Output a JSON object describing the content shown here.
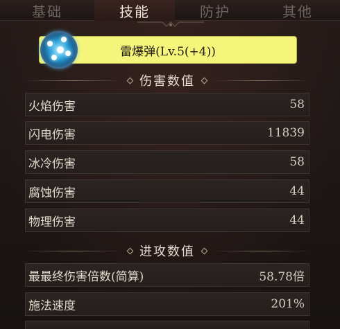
{
  "tabs": [
    {
      "label": "基础"
    },
    {
      "label": "技能"
    },
    {
      "label": "防护"
    },
    {
      "label": "其他"
    }
  ],
  "skill": {
    "name": "雷爆弹(Lv.5(+4))",
    "icon": "lightning-orb-icon"
  },
  "sections": [
    {
      "title": "伤害数值",
      "rows": [
        {
          "label": "火焰伤害",
          "value": "58"
        },
        {
          "label": "闪电伤害",
          "value": "11839"
        },
        {
          "label": "冰冷伤害",
          "value": "58"
        },
        {
          "label": "腐蚀伤害",
          "value": "44"
        },
        {
          "label": "物理伤害",
          "value": "44"
        }
      ]
    },
    {
      "title": "进攻数值",
      "rows": [
        {
          "label": "最最终伤害倍数(简算)",
          "value": "58.78倍"
        },
        {
          "label": "施法速度",
          "value": "201%"
        }
      ]
    }
  ],
  "colors": {
    "skill_banner": "#f4f57a",
    "active_tab_text": "#efe6d8",
    "inactive_tab_text": "#6f6560"
  }
}
